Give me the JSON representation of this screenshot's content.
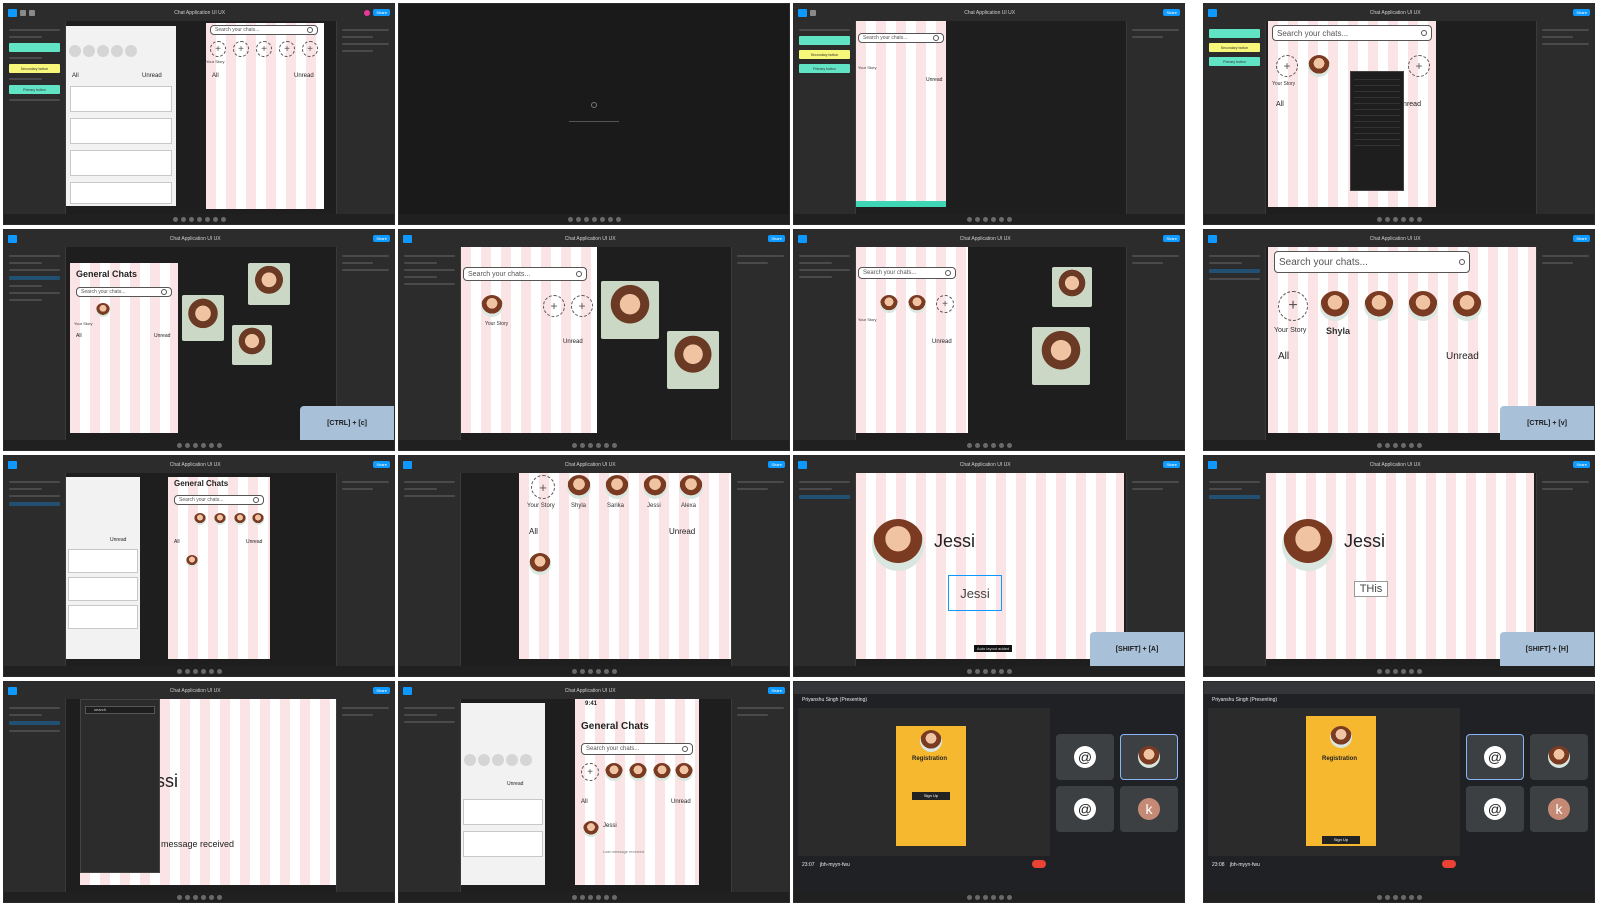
{
  "figma": {
    "file_title": "Chat Application UI UX",
    "share_label": "Share",
    "zoom": "100%"
  },
  "design_system": {
    "secondary_button": "Secondary button",
    "primary_button": "Primary button"
  },
  "chat": {
    "header": "General Chats",
    "search_placeholder": "Search your chats...",
    "story_label": "Your Story",
    "tab_all": "All",
    "tab_unread": "Unread",
    "time": "9:41",
    "last_message": "Last message received",
    "last_message_fragment": "t message received",
    "contacts": [
      "Shyla",
      "Sarika",
      "Jessi",
      "Alexa"
    ]
  },
  "profile": {
    "name": "Jessi",
    "name_fragment": "Jessi",
    "typing": "THis",
    "auto_layout_tip": "Auto layout added"
  },
  "shortcuts": {
    "copy": "[CTRL] + [c]",
    "paste": "[CTRL] + [v]",
    "auto_layout": "[SHIFT] + [A]",
    "hide": "[SHIFT] + [H]"
  },
  "meet": {
    "presenting": "Priyanshu Singh (Presenting)",
    "registration": "Registration",
    "sign_up": "Sign Up",
    "tile_letter": "k",
    "at_symbol": "@",
    "clock_1": "23:07",
    "clock_2": "23:08",
    "meeting_code": "jbh-myyn-fwu"
  },
  "search_panel_query": "search"
}
